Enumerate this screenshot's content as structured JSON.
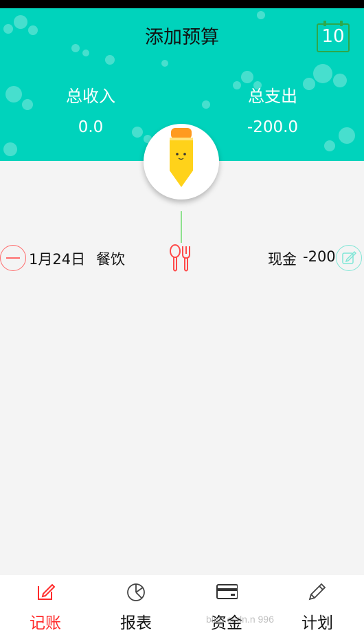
{
  "header": {
    "title": "添加预算",
    "calendar_day": "10",
    "income_label": "总收入",
    "income_value": "0.0",
    "expense_label": "总支出",
    "expense_value": "-200.0"
  },
  "records": [
    {
      "date": "1月24日",
      "category": "餐饮",
      "category_icon": "fork-spoon-icon",
      "account": "现金",
      "amount": "-200"
    }
  ],
  "nav": {
    "items": [
      {
        "label": "记账",
        "icon": "pencil-square-icon",
        "active": true
      },
      {
        "label": "报表",
        "icon": "pie-chart-icon",
        "active": false
      },
      {
        "label": "资金",
        "icon": "credit-card-icon",
        "active": false
      },
      {
        "label": "计划",
        "icon": "pencil-icon",
        "active": false
      }
    ]
  },
  "watermark": "blog.csdn.n 996",
  "colors": {
    "header_bg": "#00d3bc",
    "active_nav": "#ff2a2a",
    "delete_accent": "#ff6b6b",
    "edit_accent": "#7fe6d6",
    "pencil_body": "#ffd21a",
    "pencil_cap": "#ff9a1f"
  }
}
